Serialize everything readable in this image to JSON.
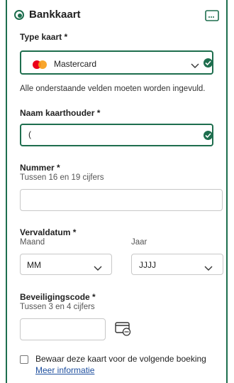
{
  "payment": {
    "method_label": "Bankkaart",
    "card_type": {
      "label": "Type kaart *",
      "value": "Mastercard"
    },
    "required_notice": "Alle onderstaande velden moeten worden ingevuld.",
    "holder": {
      "label": "Naam kaarthouder *",
      "value": "("
    },
    "number": {
      "label": "Nummer *",
      "hint": "Tussen 16 en 19 cijfers",
      "value": ""
    },
    "expiry": {
      "label": "Vervaldatum *",
      "month_label": "Maand",
      "year_label": "Jaar",
      "month_value": "MM",
      "year_value": "JJJJ"
    },
    "security": {
      "label": "Beveiligingscode *",
      "hint": "Tussen 3 en 4 cijfers",
      "value": ""
    },
    "save_card": {
      "label": "Bewaar deze kaart voor de volgende boeking",
      "checked": false
    },
    "more_info": "Meer informatie"
  },
  "colors": {
    "accent": "#1e6e4e",
    "link": "#1d4e9e",
    "border": "#c8c8c8"
  },
  "icons": [
    "radio-selected-icon",
    "card-icon",
    "mastercard-icon",
    "chevron-down-icon",
    "check-icon",
    "cvc-card-icon"
  ]
}
